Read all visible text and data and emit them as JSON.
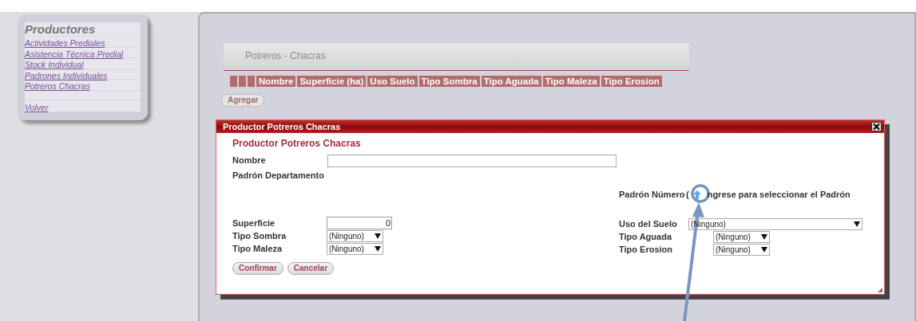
{
  "sidebar": {
    "title": "Productores",
    "links": [
      {
        "label": "Actividades Prediales",
        "kind": "link"
      },
      {
        "label": "Asistencia Técnica Predial",
        "kind": "link"
      },
      {
        "label": "Stock Individual",
        "kind": "link"
      },
      {
        "label": "Padrones Individuales",
        "kind": "link"
      },
      {
        "label": "Potreros Chacras",
        "kind": "link"
      },
      {
        "kind": "spacer"
      },
      {
        "label": "Volver",
        "kind": "link"
      }
    ]
  },
  "main": {
    "panel_title": "Potreros - Chacras",
    "table": {
      "columns": [
        {
          "kind": "blank"
        },
        {
          "kind": "blank"
        },
        {
          "kind": "blank"
        },
        {
          "kind": "text",
          "label": "Nombre"
        },
        {
          "kind": "text",
          "label": "Superficie (ha)"
        },
        {
          "kind": "text",
          "label": "Uso Suelo"
        },
        {
          "kind": "text",
          "label": "Tipo Sombra"
        },
        {
          "kind": "text",
          "label": "Tipo Aguada"
        },
        {
          "kind": "text",
          "label": "Tipo Maleza"
        },
        {
          "kind": "text",
          "label": "Tipo Erosion"
        }
      ]
    },
    "add_button": "Agregar"
  },
  "dialog": {
    "title": "Productor Potreros Chacras",
    "heading": "Productor Potreros Chacras",
    "nombre": {
      "label": "Nombre"
    },
    "padron_departamento": {
      "label": "Padrón Departamento"
    },
    "padron_numero": {
      "label": "Padrón Número",
      "prefix": "(",
      "hint": "ngrese para seleccionar el Padrón"
    },
    "left_fields": [
      {
        "kind": "number",
        "label": "Superficie",
        "value": "0"
      },
      {
        "kind": "select",
        "label": "Tipo Sombra",
        "value": "(Ninguno)"
      },
      {
        "kind": "select",
        "label": "Tipo Maleza",
        "value": "(Ninguno)"
      }
    ],
    "right_fields": [
      {
        "kind": "select_wide",
        "label": "Uso del Suelo",
        "value": "(Ninguno)"
      },
      {
        "kind": "select",
        "label": "Tipo Aguada",
        "value": "(Ninguno)"
      },
      {
        "kind": "select",
        "label": "Tipo Erosion",
        "value": "(Ninguno)"
      }
    ],
    "buttons": [
      "Confirmar",
      "Cancelar"
    ]
  }
}
